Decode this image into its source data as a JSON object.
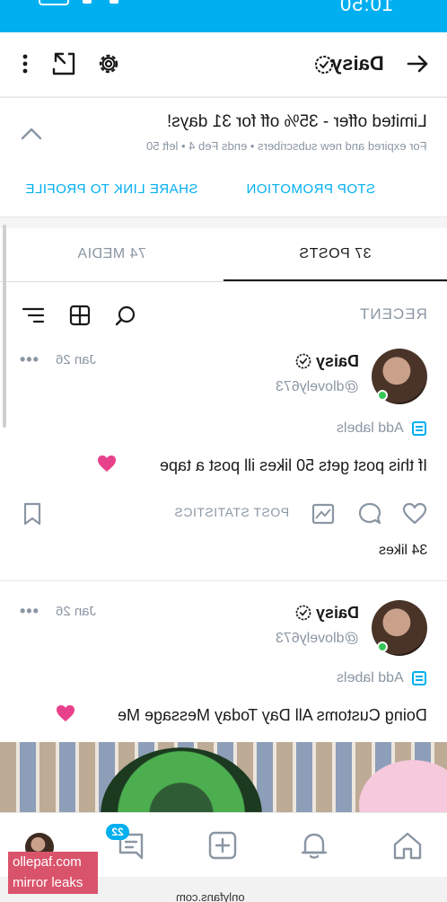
{
  "status_bar": {
    "time": "10:50"
  },
  "header": {
    "title": "Daisy",
    "icons": [
      "arrow-right-icon",
      "verified-icon",
      "settings-gear-icon",
      "share-icon",
      "more-vertical-icon"
    ]
  },
  "promo": {
    "title": "Limited offer - 35% off for 31 days!",
    "subtitle": "For expired and new subscribers  •  ends Feb 4  •  left 50",
    "stop_label": "STOP PROMOTION",
    "share_label": "SHARE LINK TO PROFILE"
  },
  "tabs": [
    {
      "label": "37 POSTS",
      "active": true
    },
    {
      "label": "74 MEDIA",
      "active": false
    }
  ],
  "filter": {
    "label": "RECENT",
    "icons": [
      "search-icon",
      "grid-icon",
      "sort-icon"
    ]
  },
  "posts": [
    {
      "name": "Daisy",
      "handle": "@dlovely673",
      "date": "Jan 26",
      "more": "•••",
      "add_labels": "Add labels",
      "text": "If this post gets 50 likes ill post a tape",
      "stats_label": "POST STATISTICS",
      "likes": "34 likes"
    },
    {
      "name": "Daisy",
      "handle": "@dlovely673",
      "date": "Jan 26",
      "more": "•••",
      "add_labels": "Add labels",
      "text": "Doing Customs All Day Today Message Me"
    }
  ],
  "bottom_nav": {
    "badge": "22",
    "icons": [
      "home-icon",
      "bell-icon",
      "add-post-icon",
      "messages-icon",
      "profile-avatar"
    ]
  },
  "url_bar": {
    "url": "onlyfans.com"
  },
  "watermark": {
    "line1": "ollepaf.com",
    "line2": "mirror leaks"
  },
  "colors": {
    "accent": "#00aff0",
    "online": "#36c759",
    "muted": "#8a96a3",
    "watermark": "#d9546b"
  }
}
